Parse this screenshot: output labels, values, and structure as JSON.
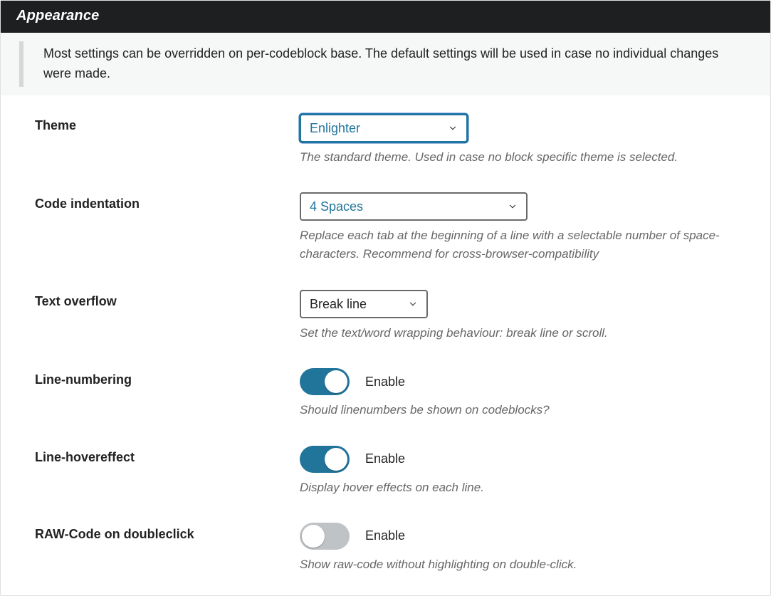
{
  "panel": {
    "title": "Appearance"
  },
  "notice": "Most settings can be overridden on per-codeblock base. The default settings will be used in case no individual changes were made.",
  "fields": {
    "theme": {
      "label": "Theme",
      "value": "Enlighter",
      "desc": "The standard theme. Used in case no block specific theme is selected."
    },
    "indent": {
      "label": "Code indentation",
      "value": "4 Spaces",
      "desc": "Replace each tab at the beginning of a line with a selectable number of space-characters. Recommend for cross-browser-compatibility"
    },
    "overflow": {
      "label": "Text overflow",
      "value": "Break line",
      "desc": "Set the text/word wrapping behaviour: break line or scroll."
    },
    "linenum": {
      "label": "Line-numbering",
      "toggle_label": "Enable",
      "enabled": true,
      "desc": "Should linenumbers be shown on codeblocks?"
    },
    "hover": {
      "label": "Line-hovereffect",
      "toggle_label": "Enable",
      "enabled": true,
      "desc": "Display hover effects on each line."
    },
    "raw": {
      "label": "RAW-Code on doubleclick",
      "toggle_label": "Enable",
      "enabled": false,
      "desc": "Show raw-code without highlighting on double-click."
    }
  }
}
